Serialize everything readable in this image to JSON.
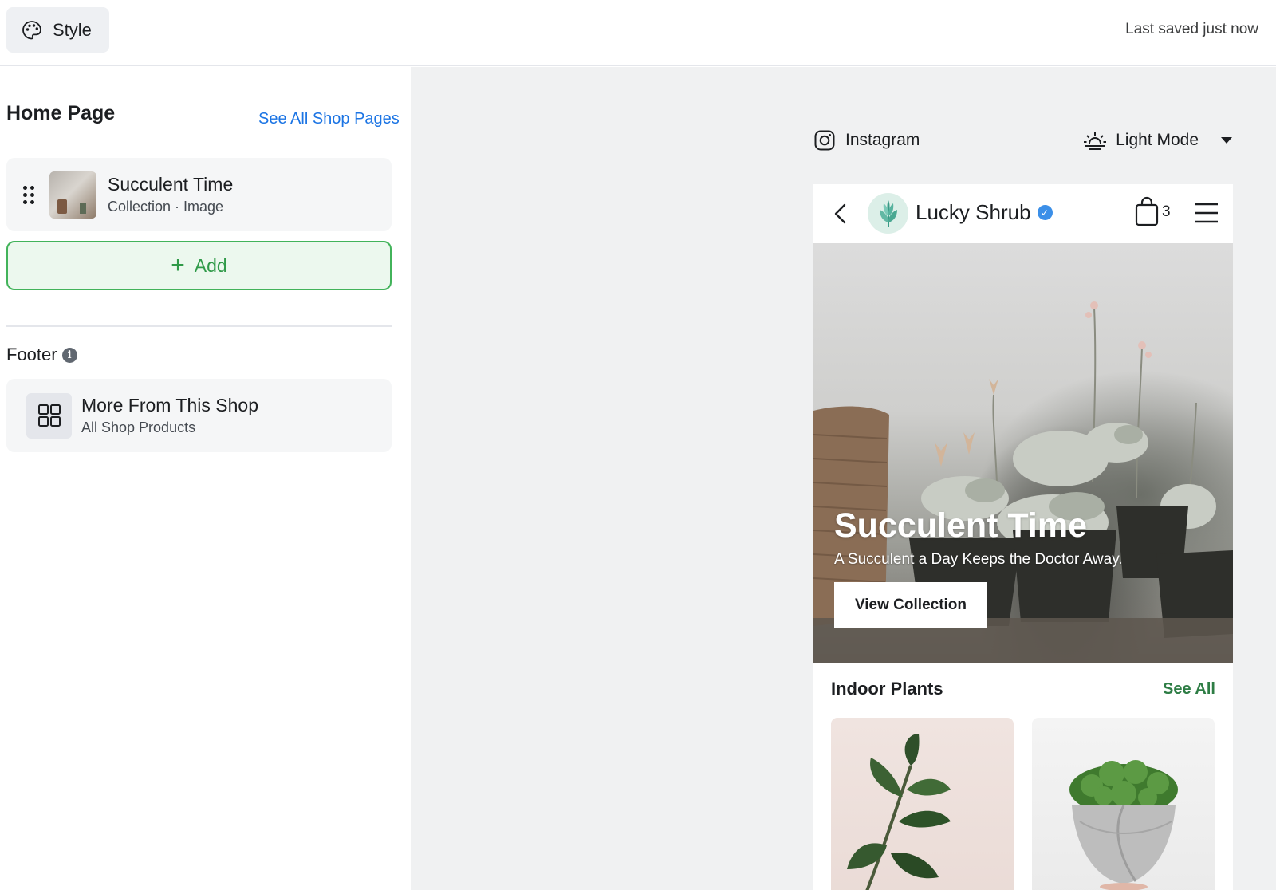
{
  "topbar": {
    "style_label": "Style",
    "last_saved": "Last saved just now"
  },
  "left": {
    "home_title": "Home Page",
    "see_all_pages": "See All Shop Pages",
    "section": {
      "title": "Succulent Time",
      "subtitle": "Collection · Image"
    },
    "add_label": "Add",
    "footer_label": "Footer",
    "footer_item": {
      "title": "More From This Shop",
      "subtitle": "All Shop Products"
    }
  },
  "preview": {
    "platform_label": "Instagram",
    "mode_label": "Light Mode",
    "shop_name": "Lucky Shrub",
    "cart_count": "3",
    "hero": {
      "title": "Succulent Time",
      "subtitle": "A Succulent a Day Keeps the Doctor Away.",
      "button": "View Collection"
    },
    "collection_title": "Indoor Plants",
    "see_all": "See All"
  },
  "colors": {
    "link_blue": "#1b74e4",
    "add_green": "#2f9a48",
    "see_all_green": "#2e7d45",
    "verified_blue": "#3b8fe8",
    "canvas_bg": "#f0f1f2"
  },
  "icons": [
    "palette-icon",
    "drag-handle-icon",
    "plus-icon",
    "info-icon",
    "grid-icon",
    "instagram-icon",
    "sun-icon",
    "chevron-down-icon",
    "back-icon",
    "verified-icon",
    "bag-icon",
    "menu-icon"
  ]
}
